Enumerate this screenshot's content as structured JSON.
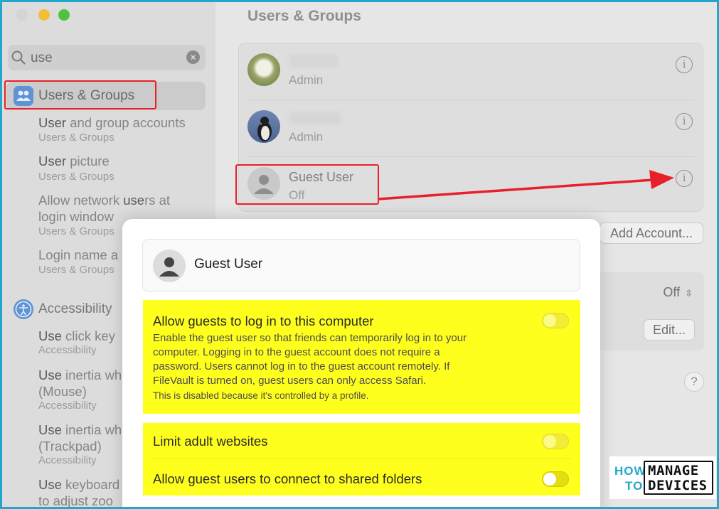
{
  "sidebar": {
    "search": {
      "value": "use"
    },
    "selected_item": {
      "label": "Users & Groups",
      "icon": "users-icon"
    },
    "results": [
      {
        "title_prefix": "User",
        "title_rest": " and group accounts",
        "sub": "Users & Groups"
      },
      {
        "title_prefix": "User",
        "title_rest": " picture",
        "sub": "Users & Groups"
      },
      {
        "title_a": "Allow network ",
        "title_b": "use",
        "title_c": "rs at",
        "title_line2": "login window",
        "sub": "Users & Groups"
      },
      {
        "title": "Login name a",
        "sub": "Users & Groups"
      }
    ],
    "accessibility": {
      "label": "Accessibility",
      "icon": "accessibility-icon",
      "items": [
        {
          "title_prefix": "Use",
          "title_rest": " click key",
          "sub": "Accessibility"
        },
        {
          "title_prefix": "Use",
          "title_rest": " inertia wh",
          "line2": "(Mouse)",
          "sub": "Accessibility"
        },
        {
          "title_prefix": "Use",
          "title_rest": " inertia wh",
          "line2": "(Trackpad)",
          "sub": "Accessibility"
        },
        {
          "title_prefix": "Use",
          "title_rest": " keyboard",
          "line2": "to adjust zoo"
        }
      ]
    }
  },
  "main": {
    "title": "Users & Groups",
    "users": [
      {
        "status": "Admin",
        "icon": "info-icon"
      },
      {
        "status": "Admin",
        "icon": "info-icon"
      },
      {
        "name": "Guest User",
        "status": "Off",
        "icon": "info-icon"
      }
    ],
    "add_account_label": "Add Account...",
    "off_selector": "Off",
    "edit_label": "Edit...",
    "help_label": "?"
  },
  "sheet": {
    "user_name": "Guest User",
    "options": [
      {
        "title": "Allow guests to log in to this computer",
        "description_lines": [
          "Enable the guest user so that friends can temporarily log in to your",
          "computer. Logging in to the guest account does not require a",
          "password. Users cannot log in to the guest account remotely. If",
          "FileVault is turned on, guest users can only access Safari."
        ],
        "note": "This is disabled because it's controlled by a profile.",
        "enabled": false
      },
      {
        "title": "Limit adult websites",
        "enabled": false
      },
      {
        "title": "Allow guest users to connect to shared folders",
        "enabled": false
      }
    ]
  },
  "logo": {
    "line1": "HOW",
    "line2": "TO",
    "word1": "MANAGE",
    "word2": "DEVICES"
  },
  "colors": {
    "highlight": "#ffff1e",
    "annotation": "#e8202a",
    "frame": "#23a6cc"
  }
}
